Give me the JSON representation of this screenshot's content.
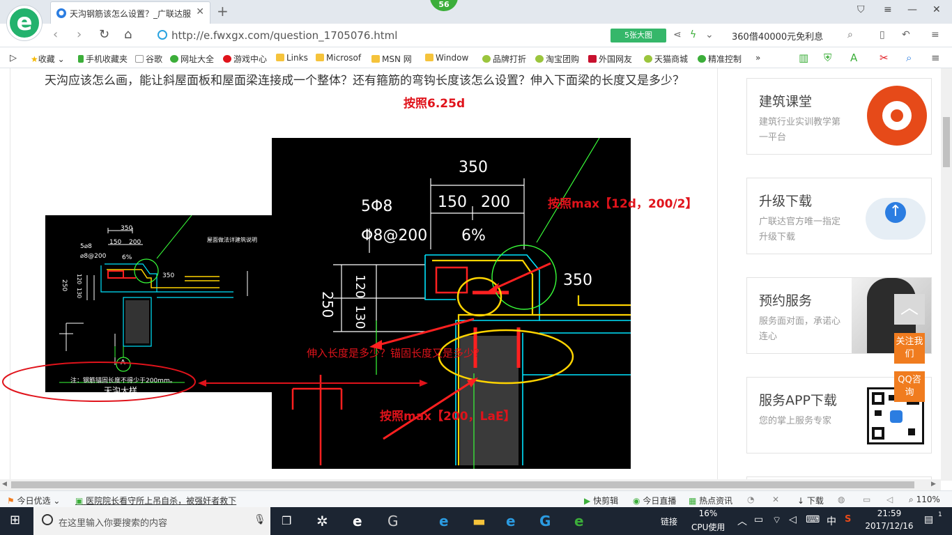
{
  "browser": {
    "badge": "56",
    "tab_title": "天沟钢筋该怎么设置？_广联达服",
    "url": "http://e.fwxgx.com/question_1705076.html",
    "bigpic_label": "5张大图",
    "ad_text": "360借40000元免利息",
    "logo_letter": "e"
  },
  "bookmarks": [
    {
      "label": "收藏"
    },
    {
      "label": "手机收藏夹"
    },
    {
      "label": "谷歌"
    },
    {
      "label": "网址大全"
    },
    {
      "label": "游戏中心"
    },
    {
      "label": "Links"
    },
    {
      "label": "Microsof"
    },
    {
      "label": "MSN 网"
    },
    {
      "label": "Window"
    },
    {
      "label": "品牌打折"
    },
    {
      "label": "淘宝团购"
    },
    {
      "label": "外国网友"
    },
    {
      "label": "天猫商城"
    },
    {
      "label": "精准控制"
    }
  ],
  "page": {
    "question": "天沟应该怎么画，能让斜屋面板和屋面梁连接成一个整体？还有箍筋的弯钩长度该怎么设置？伸入下面梁的长度又是多少？",
    "anno_top": "按照6.25d",
    "anno_right": "按照max【12d，200/2】",
    "anno_mid": "伸入长度是多少？锚固长度又是多少？",
    "anno_bottom": "按照max【200，LaE】"
  },
  "cad_small": {
    "dim_350": "350",
    "dim_150": "150",
    "dim_200": "200",
    "rebar": "5⌀8",
    "stirrup": "⌀8@200",
    "slope": "6%",
    "dim_250": "250",
    "dim_120": "120",
    "dim_130": "130",
    "dim_350b": "350",
    "axis": "A",
    "note": "屋面做法详建筑说明",
    "bottom_note": "注：钢筋锚固长度不得少于200mm。",
    "bottom_label": "天沟大样"
  },
  "cad_large": {
    "dim_350": "350",
    "dim_150": "150",
    "dim_200": "200",
    "rebar": "5Φ8",
    "stirrup": "Φ8@200",
    "slope": "6%",
    "dim_250": "250",
    "dim_120": "120",
    "dim_130": "130",
    "dim_350b": "350"
  },
  "sidebar": [
    {
      "title": "建筑课堂",
      "sub": "建筑行业实训教学第一平台"
    },
    {
      "title": "升级下载",
      "sub": "广联达官方唯一指定升级下载"
    },
    {
      "title": "预约服务",
      "sub": "服务面对面，承诺心连心"
    },
    {
      "title": "服务APP下载",
      "sub": "您的掌上服务专家"
    }
  ],
  "float": {
    "follow": "关注我们",
    "qq": "QQ咨询"
  },
  "statusbar": {
    "today": "今日优选",
    "news": "医院院长看守所上吊自杀，被强奸者救下",
    "items": [
      "快剪辑",
      "今日直播",
      "热点资讯",
      "下载"
    ],
    "zoom": "110%"
  },
  "taskbar": {
    "search_placeholder": "在这里输入你要搜索的内容",
    "link": "链接",
    "cpu_value": "16%",
    "cpu_label": "CPU使用",
    "ime": "中",
    "time": "21:59",
    "date": "2017/12/16",
    "notifications": "1"
  }
}
